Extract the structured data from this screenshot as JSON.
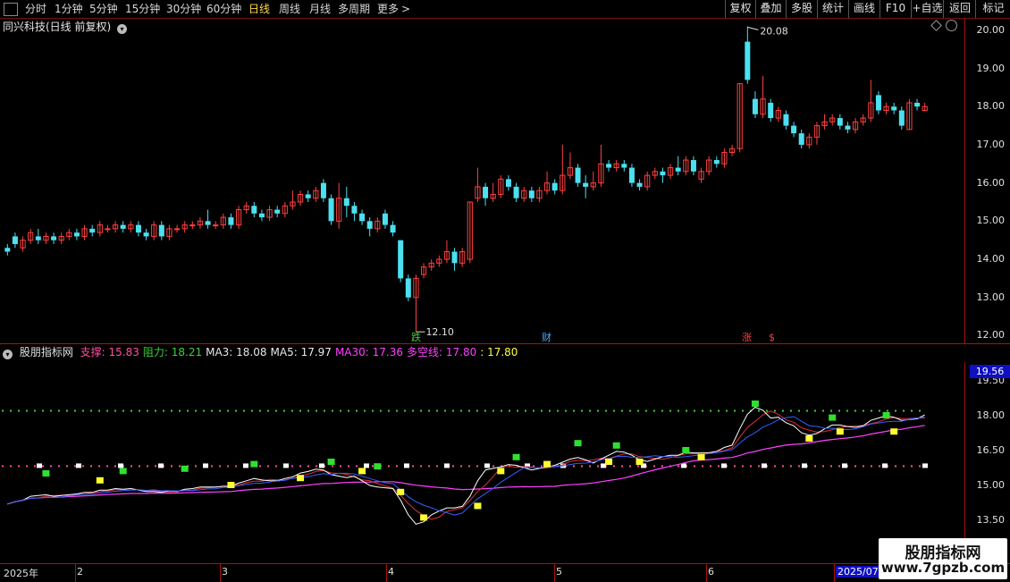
{
  "toolbar": {
    "periods": [
      "分时",
      "1分钟",
      "5分钟",
      "15分钟",
      "30分钟",
      "60分钟",
      "日线",
      "周线",
      "月线",
      "多周期",
      "更多"
    ],
    "active_period": "日线",
    "more_arrow": ">",
    "right_buttons": [
      "复权",
      "叠加",
      "多股",
      "统计",
      "画线",
      "F10",
      "+自选",
      "返回",
      "标记"
    ]
  },
  "main": {
    "title": "同兴科技(日线 前复权)",
    "max_label": "20.08",
    "min_label": "12.10",
    "event_markers": [
      {
        "text": "跌",
        "color": "#3ecf3e"
      },
      {
        "text": "财",
        "color": "#4aa8ff"
      },
      {
        "text": "涨",
        "color": "#ff4040"
      },
      {
        "text": "$",
        "color": "#ff4040"
      }
    ],
    "price_axis": [
      "20.00",
      "19.00",
      "18.00",
      "17.00",
      "16.00",
      "15.00",
      "14.00",
      "13.00",
      "12.00"
    ]
  },
  "indicator": {
    "name": "股朋指标网",
    "values": [
      {
        "label": "支撑:",
        "value": "15.83",
        "color": "#ff4fa0"
      },
      {
        "label": "阻力:",
        "value": "18.21",
        "color": "#3ecf3e"
      },
      {
        "label": "MA3:",
        "value": "18.08",
        "color": "#e8e8e8"
      },
      {
        "label": "MA5:",
        "value": "17.97",
        "color": "#e8e8e8"
      },
      {
        "label": "MA30:",
        "value": "17.36",
        "color": "#ff40ff"
      },
      {
        "label": "多空线:",
        "value": "17.80",
        "color": "#ff40ff"
      },
      {
        "label": ":",
        "value": "17.80",
        "color": "#ffff40"
      }
    ],
    "axis": [
      "19.50",
      "18.00",
      "16.50",
      "15.00",
      "13.50"
    ],
    "current_value": "19.56"
  },
  "date_axis": [
    "2025年",
    "2",
    "3",
    "4",
    "5",
    "6",
    "2025/07/"
  ],
  "watermark": {
    "line1": "股朋指标网",
    "line2": "www.7gpzb.com"
  },
  "colors": {
    "up": "#ff4040",
    "down": "#4ce0f0",
    "support": "#ff4fa0",
    "resistance": "#3ecf3e",
    "ma30": "#ff40ff"
  },
  "chart_data": {
    "type": "candlestick",
    "title": "同兴科技(日线 前复权)",
    "ylim": [
      11.8,
      20.3
    ],
    "candles": [
      [
        14.3,
        14.2,
        14.4,
        14.1
      ],
      [
        14.6,
        14.4,
        14.7,
        14.3
      ],
      [
        14.3,
        14.5,
        14.6,
        14.2
      ],
      [
        14.5,
        14.7,
        14.8,
        14.4
      ],
      [
        14.6,
        14.5,
        14.8,
        14.4
      ],
      [
        14.5,
        14.6,
        14.7,
        14.4
      ],
      [
        14.6,
        14.5,
        14.7,
        14.4
      ],
      [
        14.5,
        14.6,
        14.7,
        14.4
      ],
      [
        14.6,
        14.7,
        14.8,
        14.5
      ],
      [
        14.7,
        14.6,
        14.8,
        14.5
      ],
      [
        14.6,
        14.8,
        14.9,
        14.5
      ],
      [
        14.8,
        14.7,
        14.9,
        14.6
      ],
      [
        14.7,
        14.9,
        15.0,
        14.6
      ],
      [
        14.8,
        14.8,
        14.9,
        14.7
      ],
      [
        14.8,
        14.9,
        15.0,
        14.7
      ],
      [
        14.9,
        14.8,
        15.0,
        14.7
      ],
      [
        14.8,
        14.9,
        15.0,
        14.7
      ],
      [
        14.9,
        14.7,
        15.0,
        14.6
      ],
      [
        14.7,
        14.6,
        14.8,
        14.5
      ],
      [
        14.6,
        14.9,
        15.0,
        14.5
      ],
      [
        14.9,
        14.6,
        15.0,
        14.5
      ],
      [
        14.6,
        14.8,
        14.9,
        14.5
      ],
      [
        14.8,
        14.8,
        14.9,
        14.7
      ],
      [
        14.8,
        14.9,
        15.0,
        14.7
      ],
      [
        14.9,
        14.9,
        15.0,
        14.8
      ],
      [
        14.9,
        15.0,
        15.1,
        14.8
      ],
      [
        15.0,
        14.9,
        15.3,
        14.8
      ],
      [
        14.9,
        14.9,
        15.0,
        14.8
      ],
      [
        14.9,
        15.1,
        15.2,
        14.8
      ],
      [
        15.1,
        14.9,
        15.2,
        14.8
      ],
      [
        14.9,
        15.3,
        15.4,
        14.8
      ],
      [
        15.3,
        15.4,
        15.5,
        15.2
      ],
      [
        15.4,
        15.2,
        15.5,
        15.1
      ],
      [
        15.2,
        15.1,
        15.3,
        15.0
      ],
      [
        15.1,
        15.3,
        15.4,
        15.0
      ],
      [
        15.3,
        15.2,
        15.4,
        15.1
      ],
      [
        15.2,
        15.4,
        15.5,
        15.1
      ],
      [
        15.4,
        15.5,
        15.8,
        15.3
      ],
      [
        15.5,
        15.7,
        15.8,
        15.4
      ],
      [
        15.7,
        15.6,
        15.8,
        15.5
      ],
      [
        15.6,
        15.8,
        15.9,
        15.5
      ],
      [
        16.0,
        15.6,
        16.1,
        15.5
      ],
      [
        15.6,
        15.0,
        15.7,
        14.9
      ],
      [
        15.0,
        15.6,
        16.0,
        14.8
      ],
      [
        15.6,
        15.4,
        15.9,
        15.1
      ],
      [
        15.4,
        15.2,
        15.5,
        15.0
      ],
      [
        15.2,
        15.0,
        15.3,
        14.9
      ],
      [
        15.0,
        14.8,
        15.1,
        14.6
      ],
      [
        14.8,
        15.0,
        15.1,
        14.7
      ],
      [
        15.2,
        14.9,
        15.3,
        14.8
      ],
      [
        14.9,
        14.7,
        15.0,
        14.6
      ],
      [
        14.5,
        13.5,
        14.5,
        13.4
      ],
      [
        13.5,
        13.0,
        13.6,
        12.9
      ],
      [
        13.0,
        13.5,
        13.6,
        12.1
      ],
      [
        13.6,
        13.8,
        13.9,
        13.5
      ],
      [
        13.8,
        13.9,
        14.0,
        13.7
      ],
      [
        13.9,
        14.0,
        14.1,
        13.8
      ],
      [
        14.0,
        14.2,
        14.5,
        13.9
      ],
      [
        14.2,
        13.9,
        14.3,
        13.7
      ],
      [
        13.9,
        14.2,
        14.3,
        13.8
      ],
      [
        14.0,
        15.5,
        15.5,
        13.9
      ],
      [
        15.6,
        15.9,
        16.4,
        15.5
      ],
      [
        15.9,
        15.6,
        16.0,
        15.4
      ],
      [
        15.6,
        15.7,
        16.0,
        15.5
      ],
      [
        15.7,
        16.1,
        16.2,
        15.6
      ],
      [
        16.1,
        15.9,
        16.2,
        15.8
      ],
      [
        15.9,
        15.6,
        16.0,
        15.5
      ],
      [
        15.6,
        15.8,
        15.9,
        15.5
      ],
      [
        15.8,
        15.6,
        15.9,
        15.5
      ],
      [
        15.6,
        15.8,
        15.9,
        15.5
      ],
      [
        15.8,
        16.0,
        16.3,
        15.7
      ],
      [
        16.0,
        15.8,
        16.1,
        15.7
      ],
      [
        15.8,
        16.2,
        17.0,
        15.7
      ],
      [
        16.2,
        16.4,
        16.8,
        16.1
      ],
      [
        16.4,
        16.0,
        16.5,
        15.9
      ],
      [
        16.0,
        15.9,
        16.2,
        15.6
      ],
      [
        15.9,
        16.0,
        16.3,
        15.8
      ],
      [
        16.0,
        16.5,
        17.0,
        15.9
      ],
      [
        16.5,
        16.4,
        16.6,
        16.3
      ],
      [
        16.4,
        16.5,
        16.6,
        16.3
      ],
      [
        16.5,
        16.4,
        16.6,
        16.3
      ],
      [
        16.4,
        16.0,
        16.5,
        15.9
      ],
      [
        16.0,
        15.9,
        16.1,
        15.8
      ],
      [
        15.9,
        16.2,
        16.3,
        15.8
      ],
      [
        16.2,
        16.3,
        16.4,
        16.1
      ],
      [
        16.3,
        16.2,
        16.4,
        16.0
      ],
      [
        16.2,
        16.4,
        16.5,
        16.1
      ],
      [
        16.4,
        16.3,
        16.7,
        16.2
      ],
      [
        16.3,
        16.6,
        16.7,
        16.2
      ],
      [
        16.6,
        16.3,
        16.7,
        16.2
      ],
      [
        16.1,
        16.3,
        16.4,
        16.0
      ],
      [
        16.3,
        16.6,
        16.7,
        16.2
      ],
      [
        16.6,
        16.5,
        16.7,
        16.4
      ],
      [
        16.5,
        16.8,
        16.9,
        16.4
      ],
      [
        16.8,
        16.9,
        17.0,
        16.7
      ],
      [
        16.9,
        18.6,
        18.6,
        16.8
      ],
      [
        19.7,
        18.7,
        20.1,
        18.6
      ],
      [
        18.2,
        17.8,
        18.4,
        17.7
      ],
      [
        17.8,
        18.2,
        18.8,
        17.7
      ],
      [
        18.1,
        17.7,
        18.2,
        17.6
      ],
      [
        17.7,
        17.9,
        18.0,
        17.6
      ],
      [
        17.8,
        17.5,
        17.9,
        17.4
      ],
      [
        17.5,
        17.3,
        17.6,
        17.2
      ],
      [
        17.3,
        17.0,
        17.4,
        16.9
      ],
      [
        17.0,
        17.2,
        17.3,
        16.9
      ],
      [
        17.2,
        17.5,
        17.6,
        17.0
      ],
      [
        17.5,
        17.6,
        17.8,
        17.4
      ],
      [
        17.6,
        17.7,
        17.8,
        17.5
      ],
      [
        17.7,
        17.5,
        17.8,
        17.4
      ],
      [
        17.5,
        17.4,
        17.6,
        17.3
      ],
      [
        17.4,
        17.6,
        17.7,
        17.3
      ],
      [
        17.6,
        17.7,
        17.8,
        17.5
      ],
      [
        17.7,
        18.1,
        18.7,
        17.6
      ],
      [
        18.3,
        17.9,
        18.4,
        17.8
      ],
      [
        17.9,
        18.0,
        18.1,
        17.8
      ],
      [
        18.0,
        17.9,
        18.1,
        17.8
      ],
      [
        17.9,
        17.5,
        18.0,
        17.4
      ],
      [
        17.4,
        18.1,
        18.2,
        17.4
      ],
      [
        18.1,
        18.0,
        18.2,
        17.9
      ],
      [
        17.9,
        18.0,
        18.1,
        17.9
      ]
    ]
  }
}
